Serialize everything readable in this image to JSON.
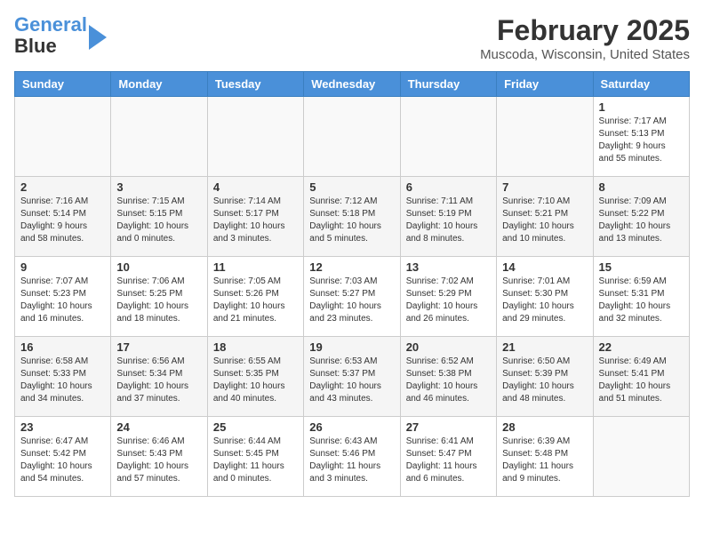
{
  "header": {
    "logo_line1": "General",
    "logo_line2": "Blue",
    "month_title": "February 2025",
    "location": "Muscoda, Wisconsin, United States"
  },
  "weekdays": [
    "Sunday",
    "Monday",
    "Tuesday",
    "Wednesday",
    "Thursday",
    "Friday",
    "Saturday"
  ],
  "weeks": [
    [
      {
        "day": "",
        "info": ""
      },
      {
        "day": "",
        "info": ""
      },
      {
        "day": "",
        "info": ""
      },
      {
        "day": "",
        "info": ""
      },
      {
        "day": "",
        "info": ""
      },
      {
        "day": "",
        "info": ""
      },
      {
        "day": "1",
        "info": "Sunrise: 7:17 AM\nSunset: 5:13 PM\nDaylight: 9 hours\nand 55 minutes."
      }
    ],
    [
      {
        "day": "2",
        "info": "Sunrise: 7:16 AM\nSunset: 5:14 PM\nDaylight: 9 hours\nand 58 minutes."
      },
      {
        "day": "3",
        "info": "Sunrise: 7:15 AM\nSunset: 5:15 PM\nDaylight: 10 hours\nand 0 minutes."
      },
      {
        "day": "4",
        "info": "Sunrise: 7:14 AM\nSunset: 5:17 PM\nDaylight: 10 hours\nand 3 minutes."
      },
      {
        "day": "5",
        "info": "Sunrise: 7:12 AM\nSunset: 5:18 PM\nDaylight: 10 hours\nand 5 minutes."
      },
      {
        "day": "6",
        "info": "Sunrise: 7:11 AM\nSunset: 5:19 PM\nDaylight: 10 hours\nand 8 minutes."
      },
      {
        "day": "7",
        "info": "Sunrise: 7:10 AM\nSunset: 5:21 PM\nDaylight: 10 hours\nand 10 minutes."
      },
      {
        "day": "8",
        "info": "Sunrise: 7:09 AM\nSunset: 5:22 PM\nDaylight: 10 hours\nand 13 minutes."
      }
    ],
    [
      {
        "day": "9",
        "info": "Sunrise: 7:07 AM\nSunset: 5:23 PM\nDaylight: 10 hours\nand 16 minutes."
      },
      {
        "day": "10",
        "info": "Sunrise: 7:06 AM\nSunset: 5:25 PM\nDaylight: 10 hours\nand 18 minutes."
      },
      {
        "day": "11",
        "info": "Sunrise: 7:05 AM\nSunset: 5:26 PM\nDaylight: 10 hours\nand 21 minutes."
      },
      {
        "day": "12",
        "info": "Sunrise: 7:03 AM\nSunset: 5:27 PM\nDaylight: 10 hours\nand 23 minutes."
      },
      {
        "day": "13",
        "info": "Sunrise: 7:02 AM\nSunset: 5:29 PM\nDaylight: 10 hours\nand 26 minutes."
      },
      {
        "day": "14",
        "info": "Sunrise: 7:01 AM\nSunset: 5:30 PM\nDaylight: 10 hours\nand 29 minutes."
      },
      {
        "day": "15",
        "info": "Sunrise: 6:59 AM\nSunset: 5:31 PM\nDaylight: 10 hours\nand 32 minutes."
      }
    ],
    [
      {
        "day": "16",
        "info": "Sunrise: 6:58 AM\nSunset: 5:33 PM\nDaylight: 10 hours\nand 34 minutes."
      },
      {
        "day": "17",
        "info": "Sunrise: 6:56 AM\nSunset: 5:34 PM\nDaylight: 10 hours\nand 37 minutes."
      },
      {
        "day": "18",
        "info": "Sunrise: 6:55 AM\nSunset: 5:35 PM\nDaylight: 10 hours\nand 40 minutes."
      },
      {
        "day": "19",
        "info": "Sunrise: 6:53 AM\nSunset: 5:37 PM\nDaylight: 10 hours\nand 43 minutes."
      },
      {
        "day": "20",
        "info": "Sunrise: 6:52 AM\nSunset: 5:38 PM\nDaylight: 10 hours\nand 46 minutes."
      },
      {
        "day": "21",
        "info": "Sunrise: 6:50 AM\nSunset: 5:39 PM\nDaylight: 10 hours\nand 48 minutes."
      },
      {
        "day": "22",
        "info": "Sunrise: 6:49 AM\nSunset: 5:41 PM\nDaylight: 10 hours\nand 51 minutes."
      }
    ],
    [
      {
        "day": "23",
        "info": "Sunrise: 6:47 AM\nSunset: 5:42 PM\nDaylight: 10 hours\nand 54 minutes."
      },
      {
        "day": "24",
        "info": "Sunrise: 6:46 AM\nSunset: 5:43 PM\nDaylight: 10 hours\nand 57 minutes."
      },
      {
        "day": "25",
        "info": "Sunrise: 6:44 AM\nSunset: 5:45 PM\nDaylight: 11 hours\nand 0 minutes."
      },
      {
        "day": "26",
        "info": "Sunrise: 6:43 AM\nSunset: 5:46 PM\nDaylight: 11 hours\nand 3 minutes."
      },
      {
        "day": "27",
        "info": "Sunrise: 6:41 AM\nSunset: 5:47 PM\nDaylight: 11 hours\nand 6 minutes."
      },
      {
        "day": "28",
        "info": "Sunrise: 6:39 AM\nSunset: 5:48 PM\nDaylight: 11 hours\nand 9 minutes."
      },
      {
        "day": "",
        "info": ""
      }
    ]
  ]
}
